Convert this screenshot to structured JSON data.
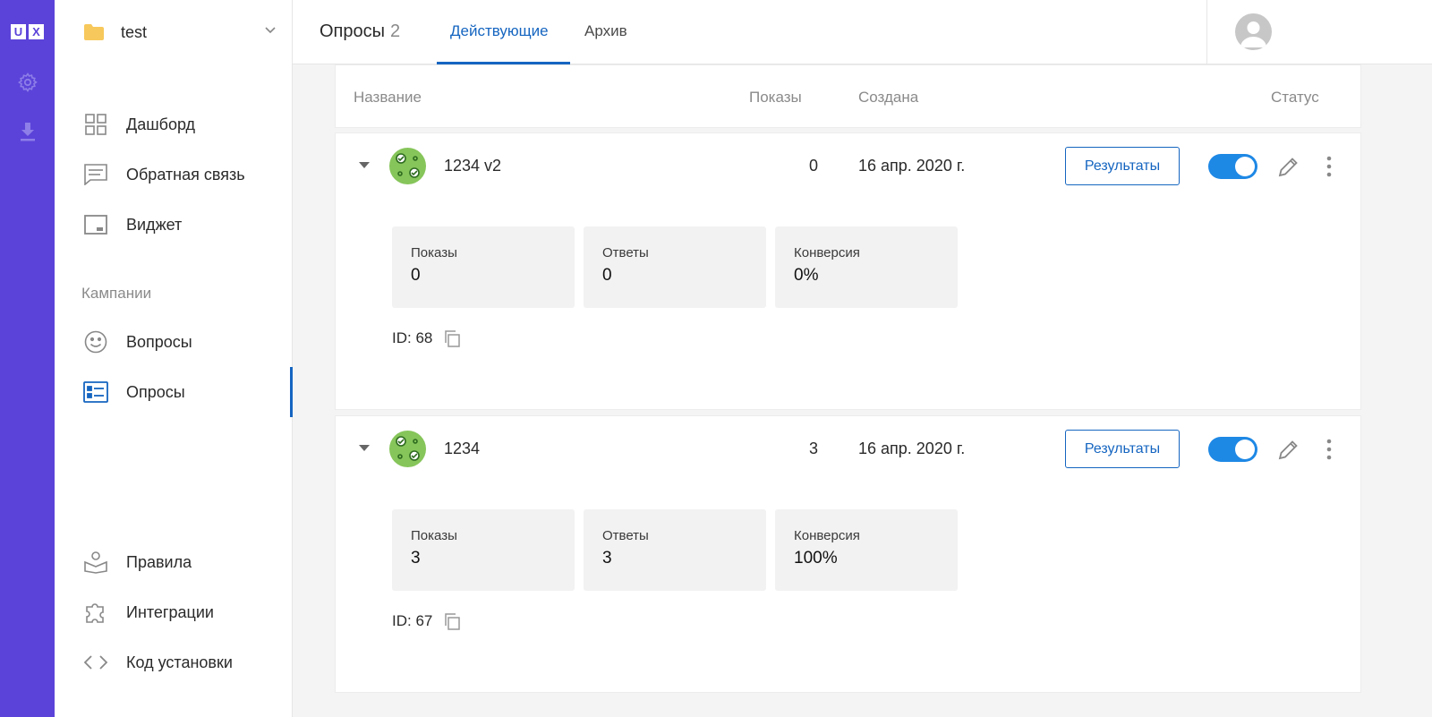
{
  "brand": {
    "logo_letters": [
      "U",
      "X"
    ],
    "accent": "#5b43d9",
    "primary": "#1565c0"
  },
  "rail": {
    "icons": [
      "gear-icon",
      "download-icon"
    ]
  },
  "project": {
    "name": "test"
  },
  "nav": {
    "items": [
      {
        "label": "Дашборд",
        "icon": "grid-icon"
      },
      {
        "label": "Обратная связь",
        "icon": "feedback-icon"
      },
      {
        "label": "Виджет",
        "icon": "widget-icon"
      }
    ],
    "campaigns_title": "Кампании",
    "campaign_items": [
      {
        "label": "Вопросы",
        "icon": "smiley-icon"
      },
      {
        "label": "Опросы",
        "icon": "survey-list-icon",
        "active": true
      }
    ],
    "bottom_items": [
      {
        "label": "Правила",
        "icon": "rules-icon"
      },
      {
        "label": "Интеграции",
        "icon": "puzzle-icon"
      },
      {
        "label": "Код установки",
        "icon": "code-icon"
      }
    ]
  },
  "header": {
    "title": "Опросы",
    "count": "2",
    "tabs": [
      {
        "label": "Действующие",
        "active": true
      },
      {
        "label": "Архив",
        "active": false
      }
    ]
  },
  "table": {
    "columns": {
      "name": "Название",
      "shows": "Показы",
      "created": "Создана",
      "status": "Статус"
    }
  },
  "surveys": [
    {
      "name": "1234 v2",
      "shows": "0",
      "created": "16 апр. 2020 г.",
      "results_label": "Результаты",
      "enabled": true,
      "stats": [
        {
          "label": "Показы",
          "value": "0"
        },
        {
          "label": "Ответы",
          "value": "0"
        },
        {
          "label": "Конверсия",
          "value": "0%"
        }
      ],
      "id_text": "ID: 68"
    },
    {
      "name": "1234",
      "shows": "3",
      "created": "16 апр. 2020 г.",
      "results_label": "Результаты",
      "enabled": true,
      "stats": [
        {
          "label": "Показы",
          "value": "3"
        },
        {
          "label": "Ответы",
          "value": "3"
        },
        {
          "label": "Конверсия",
          "value": "100%"
        }
      ],
      "id_text": "ID: 67"
    }
  ]
}
